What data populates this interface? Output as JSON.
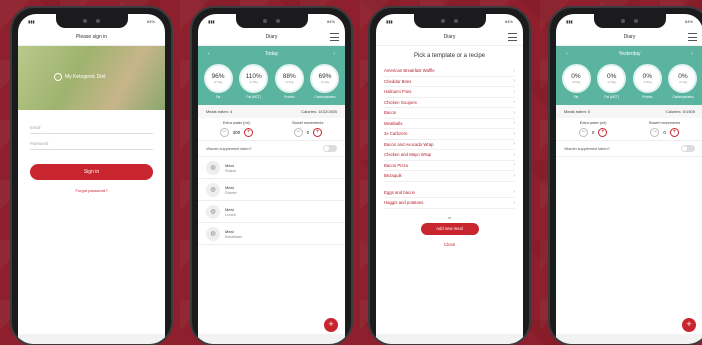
{
  "brand": {
    "accent": "#c8252f",
    "teal": "#5ab4a0",
    "background": "#8e1f2c"
  },
  "status": {
    "time": "10:49",
    "time2": "11:05",
    "battery": "84%"
  },
  "login": {
    "header": "Please sign in",
    "logo_text": "My Ketogenic Diet",
    "email_placeholder": "Email",
    "password_placeholder": "Password",
    "signin_label": "Sign in",
    "forgot_label": "Forgot password?"
  },
  "diary1": {
    "header": "Diary",
    "date": "Today",
    "rings": [
      {
        "value": "96%",
        "sub": "of 94g",
        "label": "Fat"
      },
      {
        "value": "110%",
        "sub": "of 52g",
        "label": "Fat (MCT)"
      },
      {
        "value": "88%",
        "sub": "of 39g",
        "label": "Protein"
      },
      {
        "value": "69%",
        "sub": "of 13g",
        "label": "Carbohydrates"
      }
    ],
    "meals_eaten": "Meals eaten: 4",
    "calories": "Calories: 1432/1505",
    "extra_water_label": "Extra water (ml)",
    "extra_water_value": "300",
    "bowel_label": "Bowel movements",
    "bowel_value": "0",
    "vitamin_label": "Vitamin supplement taken?",
    "meals": [
      {
        "title": "Meal",
        "name": "Snack"
      },
      {
        "title": "Meal",
        "name": "Dinner"
      },
      {
        "title": "Meal",
        "name": "Lunch"
      },
      {
        "title": "Meal",
        "name": "Breakfast"
      }
    ],
    "fab_label": "+"
  },
  "templates": {
    "header": "Diary",
    "pick_label": "Pick a template or a recipe",
    "items": [
      "American Breakfast Waffle",
      "Cheddar Bites",
      "Halloumi Fries",
      "Chicken Goujons",
      "Bacon",
      "Meatballs",
      "3x Carbzero",
      "Bacon and Avocado Wrap",
      "Chicken and Mayo Wrap",
      "Bacon Pizza",
      "Bezaquik"
    ],
    "items2": [
      "Eggs and bacon",
      "Haggis and potatoes"
    ],
    "or_label": "or",
    "add_label": "Add new meal",
    "close_label": "Close"
  },
  "diary2": {
    "header": "Diary",
    "date": "Yesterday",
    "rings": [
      {
        "value": "0%",
        "sub": "of 94g",
        "label": "Fat"
      },
      {
        "value": "0%",
        "sub": "of 52g",
        "label": "Fat (MCT)"
      },
      {
        "value": "0%",
        "sub": "of 39g",
        "label": "Protein"
      },
      {
        "value": "0%",
        "sub": "of 13g",
        "label": "Carbohydrates"
      }
    ],
    "meals_eaten": "Meals eaten: 0",
    "calories": "Calories: 0/1505",
    "extra_water_label": "Extra water (ml)",
    "extra_water_value": "0",
    "bowel_label": "Bowel movements",
    "bowel_value": "0",
    "vitamin_label": "Vitamin supplement taken?",
    "fab_label": "+"
  }
}
